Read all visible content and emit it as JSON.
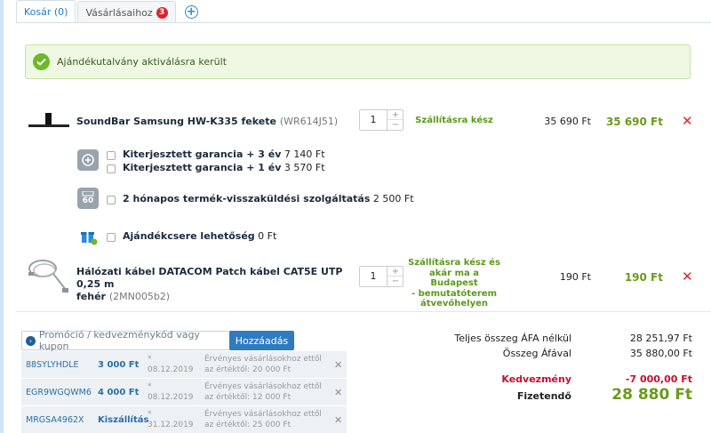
{
  "tabs": [
    {
      "label": "Kosár (0)"
    },
    {
      "label": "Vásárlásaihoz",
      "badge": "3"
    }
  ],
  "alert": {
    "text": "Ajándékutalvány aktiválásra került"
  },
  "products": [
    {
      "name": "SoundBar Samsung HW-K335 fekete",
      "code": "(WR614J51)",
      "qty": "1",
      "status": "Szállításra kész",
      "unit_price": "35 690 Ft",
      "total": "35 690 Ft"
    },
    {
      "name_line1": "Hálózati kábel DATACOM Patch kábel CAT5E UTP 0,25 m",
      "name_line2": "fehér",
      "code": "(2MN005b2)",
      "qty": "1",
      "status_line1": "Szállításra kész és",
      "status_line2": "akár ma a Budapest",
      "status_line3": "- bemutatóterem",
      "status_line4": "átvevőhelyen",
      "unit_price": "190 Ft",
      "total": "190 Ft"
    }
  ],
  "services": {
    "warranty1_label": "Kiterjesztett garancia + 3 év",
    "warranty1_price": "7 140 Ft",
    "warranty2_label": "Kiterjesztett garancia + 1 év",
    "warranty2_price": "3 570 Ft",
    "return_label": "2 hónapos termék-visszaküldési szolgáltatás",
    "return_price": "2 500 Ft",
    "return_icon_text": "60",
    "gift_label": "Ajándékcsere lehetőség",
    "gift_price": "0 Ft"
  },
  "promo": {
    "placeholder": "Promóció / kedvezménykód vagy kupon",
    "button": "Hozzáadás"
  },
  "coupons": [
    {
      "code": "88SYLYHDLE",
      "amount": "3 000 Ft",
      "date": "08.12.2019",
      "cond_line1": "Érvényes vásárlásokhoz ettől",
      "cond_line2": "az értéktől: 20 000 Ft"
    },
    {
      "code": "EGR9WGQWM6",
      "amount": "4 000 Ft",
      "date": "08.12.2019",
      "cond_line1": "Érvényes vásárlásokhoz ettől",
      "cond_line2": "az értéktől: 12 000 Ft"
    },
    {
      "code": "MRGSA4962X",
      "amount": "Kiszállítás",
      "date": "31.12.2019",
      "cond_line1": "Érvényes vásárlásokhoz ettől",
      "cond_line2": "az értéktől: 25 000 Ft"
    }
  ],
  "summary": {
    "net_label": "Teljes összeg ÁFA nélkül",
    "net_value": "28 251,97 Ft",
    "gross_label": "Összeg Áfával",
    "gross_value": "35 880,00 Ft",
    "discount_label": "Kedvezmény",
    "discount_value": "-7 000,00 Ft",
    "pay_label": "Fizetendő",
    "pay_value": "28 880 Ft"
  },
  "colors": {
    "accent": "#2e7bc2",
    "green": "#6a9a1c",
    "red": "#d9262b"
  }
}
